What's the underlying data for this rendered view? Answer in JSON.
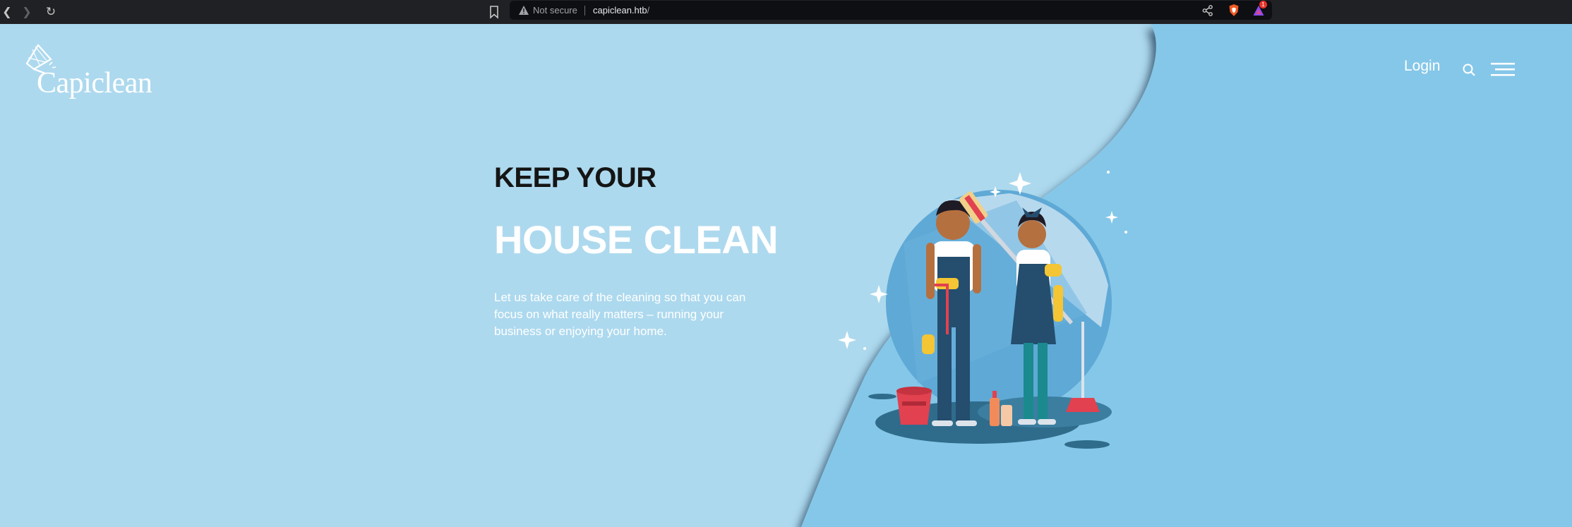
{
  "browser": {
    "nav": {
      "back_icon": "chevron-left-icon",
      "forward_icon": "chevron-right-icon",
      "reload_icon": "reload-icon"
    },
    "security_label": "Not secure",
    "url_host": "capiclean.htb",
    "url_path": "/",
    "extensions": {
      "rewards_badge": "1"
    }
  },
  "site": {
    "logo_text": "Capiclean",
    "nav": {
      "login_label": "Login",
      "search_icon": "search-icon",
      "menu_icon": "hamburger-menu-icon"
    }
  },
  "hero": {
    "kicker": "KEEP YOUR",
    "title": "HOUSE CLEAN",
    "description": "Let us take care of the cleaning so that you can focus on what really matters – running your business or enjoying your home.",
    "illustration": "two-cleaners-illustration"
  },
  "colors": {
    "chrome_bg": "#202124",
    "page_bg_left": "#add9ee",
    "page_bg_right": "#85c7e8",
    "text_dark": "#151515",
    "text_light": "#ffffff"
  }
}
